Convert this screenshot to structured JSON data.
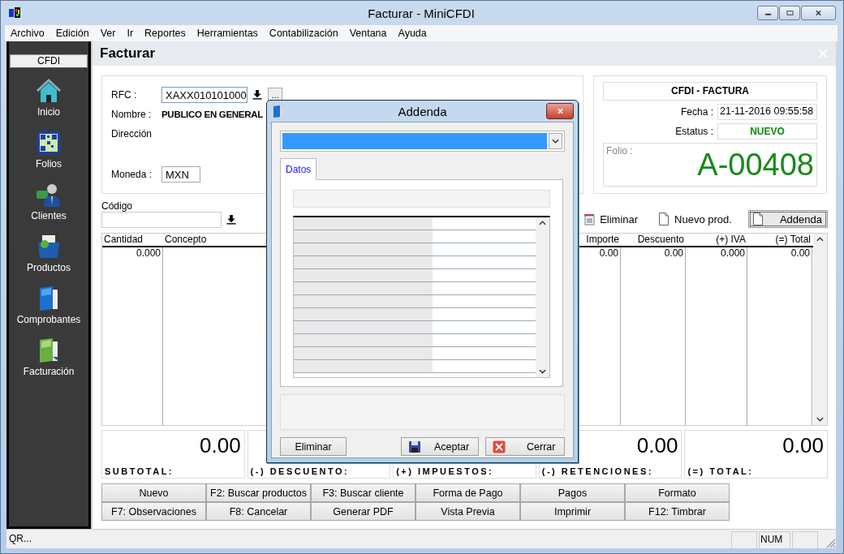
{
  "window": {
    "title": "Facturar - MiniCFDI"
  },
  "menu": [
    "Archivo",
    "Edición",
    "Ver",
    "Ir",
    "Reportes",
    "Herramientas",
    "Contabilización",
    "Ventana",
    "Ayuda"
  ],
  "sidebar": {
    "header": "CFDI",
    "items": [
      {
        "label": "Inicio",
        "kind": "home"
      },
      {
        "label": "Folios",
        "kind": "qr"
      },
      {
        "label": "Clientes",
        "kind": "person"
      },
      {
        "label": "Productos",
        "kind": "box"
      },
      {
        "label": "Comprobantes",
        "kind": "blue-folder"
      },
      {
        "label": "Facturación",
        "kind": "green-folder"
      }
    ]
  },
  "page_title": "Facturar",
  "customer": {
    "rfc_label": "RFC :",
    "rfc": "XAXX010101000",
    "more_button": "...",
    "name_label": "Nombre :",
    "name": "PUBLICO EN GENERAL",
    "address_label": "Dirección",
    "currency_label": "Moneda :",
    "currency": "MXN"
  },
  "document": {
    "type": "CFDI - FACTURA",
    "date_label": "Fecha :",
    "date": "21-11-2016 09:55:58",
    "status_label": "Estatus :",
    "status": "NUEVO",
    "folio_label": "Folio :",
    "folio": "A-00408"
  },
  "code": {
    "label": "Código"
  },
  "toolbar": [
    {
      "label": "Eliminar",
      "kind": "delete",
      "focused": false
    },
    {
      "label": "Nuevo prod.",
      "kind": "new",
      "focused": false
    },
    {
      "label": "Addenda",
      "kind": "new",
      "focused": true
    }
  ],
  "table": {
    "columns": [
      {
        "label": "Cantidad"
      },
      {
        "label": "Concepto"
      },
      {
        "label": "Importe"
      },
      {
        "label": "Descuento"
      },
      {
        "label": "(+) IVA"
      },
      {
        "label": "(=) Total"
      }
    ],
    "rows": [
      {
        "cells": [
          "0.000",
          null,
          "0.00",
          "0.00",
          "0.000",
          "0.00"
        ]
      }
    ]
  },
  "totals": [
    {
      "label": "SUBTOTAL:",
      "value": "0.00"
    },
    {
      "label": "(-) DESCUENTO:"
    },
    {
      "label": "(+) IMPUESTOS:"
    },
    {
      "label": "(-) RETENCIONES:",
      "value": "0.00"
    },
    {
      "label": "(=) TOTAL:",
      "value": "0.00"
    }
  ],
  "buttons": [
    [
      "Nuevo",
      "F2: Buscar productos",
      "F3: Buscar cliente",
      "Forma de Pago",
      "Pagos",
      "Formato"
    ],
    [
      "F7: Observaciones",
      "F8: Cancelar",
      "Generar PDF",
      "Vista Previa",
      "Imprimir",
      "F12:  Timbrar"
    ]
  ],
  "status_bar": {
    "message": "QR...",
    "indicators": [
      "NUM"
    ]
  },
  "dialog": {
    "title": "Addenda",
    "combo": {
      "highlighted": true
    },
    "tabs": [
      {
        "label": "Datos",
        "selected": true
      }
    ],
    "buttons": [
      {
        "label": "Eliminar",
        "kind": "plain"
      },
      {
        "label": "Aceptar",
        "kind": "save"
      },
      {
        "label": "Cerrar",
        "kind": "close"
      }
    ]
  }
}
